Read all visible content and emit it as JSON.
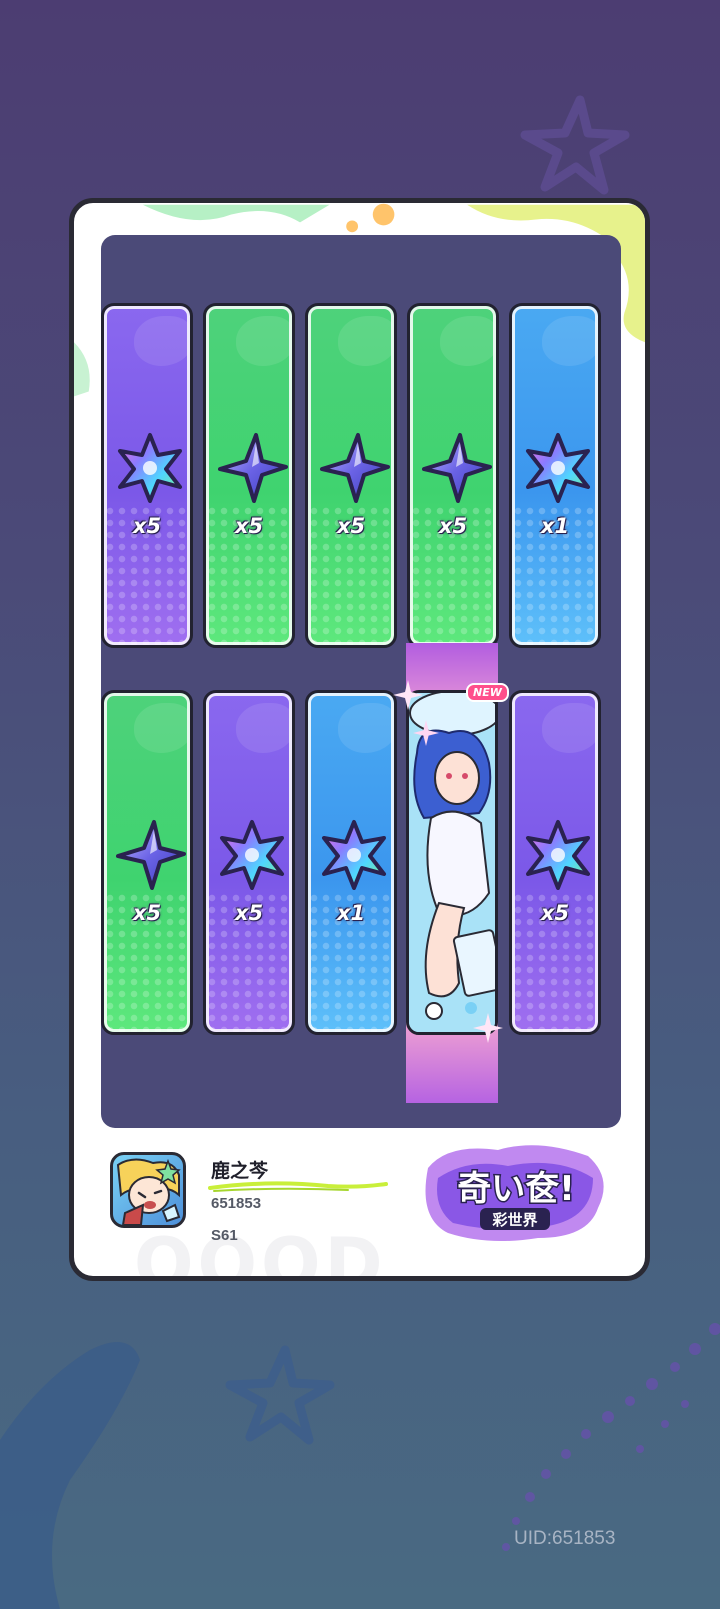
{
  "rewards_row1": [
    {
      "color": "purple",
      "item": "rainbow-crystal",
      "qty": "x5"
    },
    {
      "color": "green",
      "item": "blue-star-shard",
      "qty": "x5"
    },
    {
      "color": "green",
      "item": "blue-star-shard",
      "qty": "x5"
    },
    {
      "color": "green",
      "item": "blue-star-shard",
      "qty": "x5"
    },
    {
      "color": "blue",
      "item": "rainbow-crystal",
      "qty": "x1"
    }
  ],
  "rewards_row2": [
    {
      "color": "green",
      "item": "blue-star-shard",
      "qty": "x5"
    },
    {
      "color": "purple",
      "item": "rainbow-crystal",
      "qty": "x5"
    },
    {
      "color": "blue",
      "item": "rainbow-crystal",
      "qty": "x1"
    },
    {
      "color": "character",
      "item": "character-card",
      "badge": "NEW"
    },
    {
      "color": "purple",
      "item": "rainbow-crystal",
      "qty": "x5"
    }
  ],
  "new_badge": "NEW",
  "player": {
    "name": "鹿之芩",
    "id": "651853",
    "server": "S61"
  },
  "logo": {
    "line1": "奇い奁!",
    "line2": "彩世界"
  },
  "uid_label": "UID:651853",
  "colors": {
    "green": "#3fd36f",
    "purple": "#7b58e8",
    "blue": "#3b96ee",
    "card_border": "#2a2a34"
  }
}
